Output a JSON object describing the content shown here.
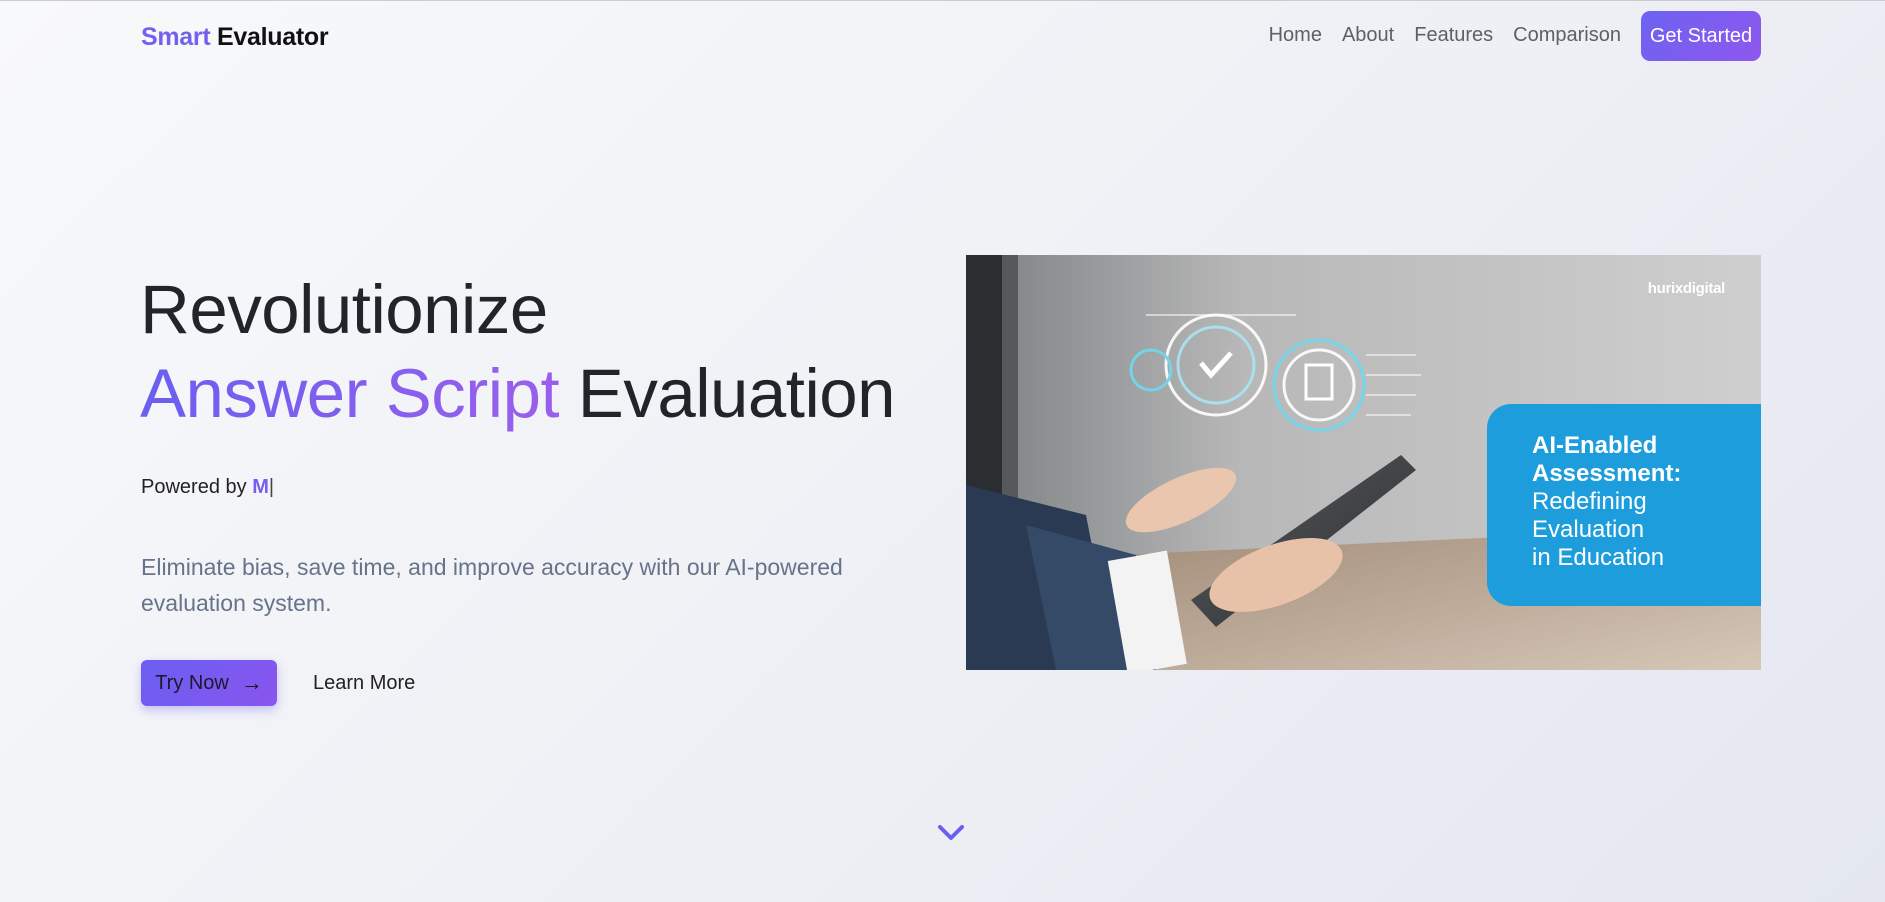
{
  "brand": {
    "accent": "Smart",
    "rest": "Evaluator"
  },
  "nav": {
    "links": [
      "Home",
      "About",
      "Features",
      "Comparison"
    ],
    "cta": "Get Started"
  },
  "hero": {
    "title_line1": "Revolutionize",
    "title_highlight": "Answer Script",
    "title_rest": "Evaluation",
    "powered_prefix": "Powered by",
    "powered_typed": "M",
    "powered_cursor": "|",
    "description": "Eliminate bias, save time, and improve accuracy with our AI-powered evaluation system.",
    "primary_button": "Try Now",
    "secondary_button": "Learn More"
  },
  "hero_image": {
    "brand": "hurixdigital",
    "card_bold_1": "AI-Enabled",
    "card_bold_2": "Assessment:",
    "card_light_1": "Redefining",
    "card_light_2": "Evaluation",
    "card_light_3": "in Education"
  },
  "icons": {
    "arrow": "arrow-right-icon",
    "scroll": "chevron-down-icon"
  },
  "colors": {
    "accent": "#7161ef",
    "accent_end": "#8f57ee",
    "card_blue": "#1d9ddc",
    "muted_text": "#67738a"
  }
}
